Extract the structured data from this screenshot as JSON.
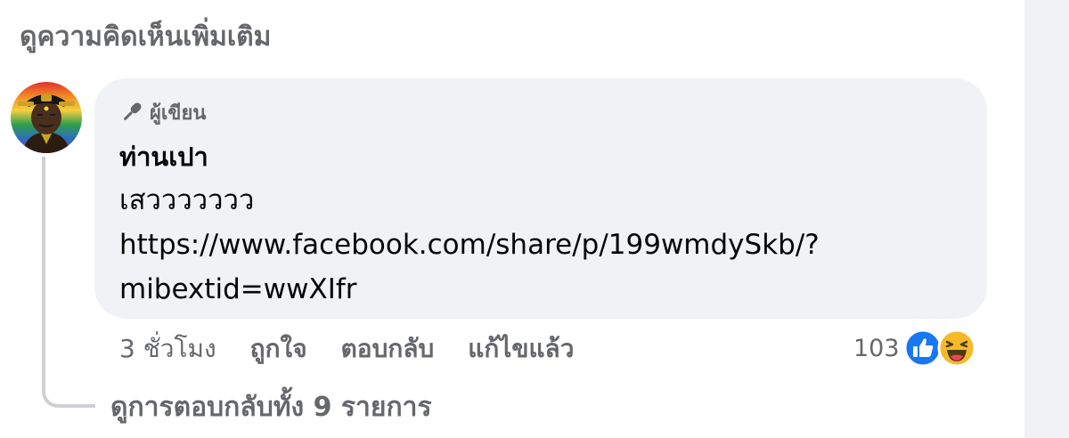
{
  "header": {
    "view_more_comments": "ดูความคิดเห็นเพิ่มเติม"
  },
  "comment": {
    "badge_label": "ผู้เขียน",
    "author_name": "ท่านเปา",
    "text_lines": [
      "เสววววววว",
      "https://www.facebook.com/share/p/199wmdySkb/?",
      "mibextid=wwXIfr"
    ],
    "actions": {
      "time": "3 ชั่วโมง",
      "like": "ถูกใจ",
      "reply": "ตอบกลับ",
      "edited": "แก้ไขแล้ว"
    },
    "reactions": {
      "count": "103",
      "icons": [
        "like-icon",
        "haha-icon"
      ]
    }
  },
  "replies": {
    "view_all": "ดูการตอบกลับทั้ง 9 รายการ"
  },
  "colors": {
    "bubble": "#f0f2f5",
    "secondary_text": "#65676b",
    "like_blue": "#1877f2",
    "haha_yellow": "#f7b928"
  }
}
